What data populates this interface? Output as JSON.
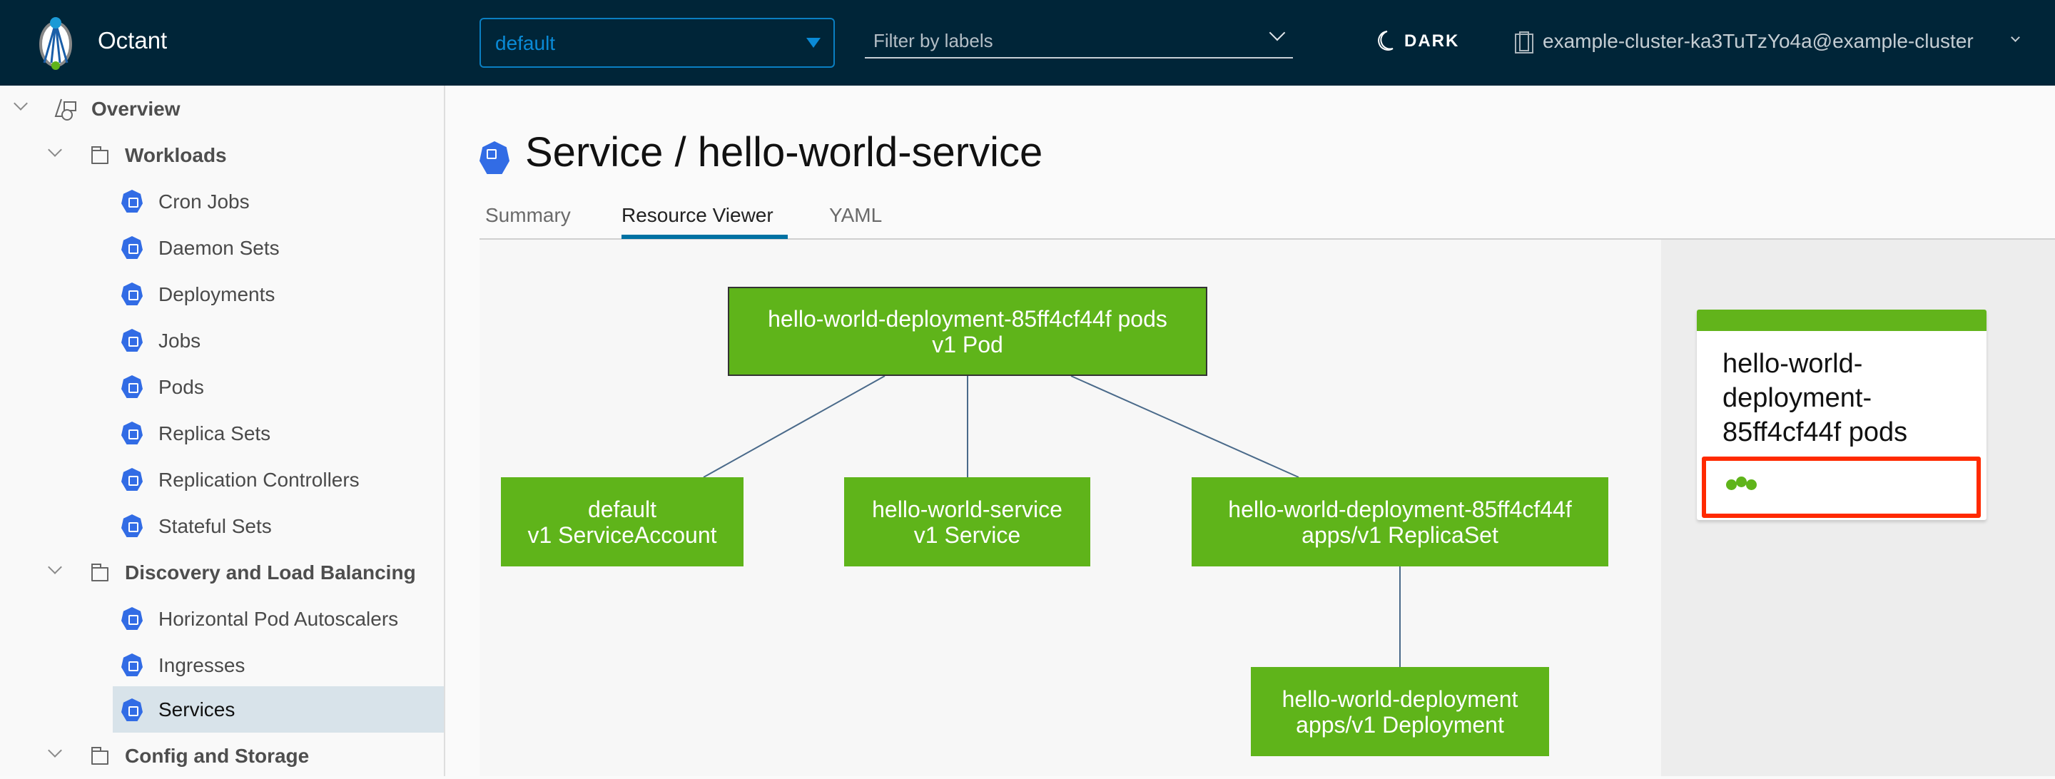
{
  "header": {
    "app_name": "Octant",
    "namespace": "default",
    "filter_placeholder": "Filter by labels",
    "theme_label": "DARK",
    "cluster": "example-cluster-ka3TuTzYo4a@example-cluster"
  },
  "sidebar": {
    "overview": "Overview",
    "workloads": {
      "label": "Workloads",
      "items": [
        "Cron Jobs",
        "Daemon Sets",
        "Deployments",
        "Jobs",
        "Pods",
        "Replica Sets",
        "Replication Controllers",
        "Stateful Sets"
      ]
    },
    "discovery": {
      "label": "Discovery and Load Balancing",
      "items": [
        "Horizontal Pod Autoscalers",
        "Ingresses",
        "Services"
      ]
    },
    "config": {
      "label": "Config and Storage"
    },
    "selected": "Services"
  },
  "page": {
    "title": "Service / hello-world-service",
    "tabs": [
      "Summary",
      "Resource Viewer",
      "YAML"
    ],
    "active_tab": "Resource Viewer"
  },
  "graph": {
    "nodes": [
      {
        "name": "hello-world-deployment-85ff4cf44f pods",
        "kind": "v1 Pod"
      },
      {
        "name": "default",
        "kind": "v1 ServiceAccount"
      },
      {
        "name": "hello-world-service",
        "kind": "v1 Service"
      },
      {
        "name": "hello-world-deployment-85ff4cf44f",
        "kind": "apps/v1 ReplicaSet"
      },
      {
        "name": "hello-world-deployment",
        "kind": "apps/v1 Deployment"
      }
    ],
    "node_color": "#5fb41a"
  },
  "detail_card": {
    "title": "hello-world-deployment-85ff4cf44f pods",
    "pod_status_count": 3,
    "status_color": "#5fb41a",
    "highlight_color": "#ff2a00"
  }
}
